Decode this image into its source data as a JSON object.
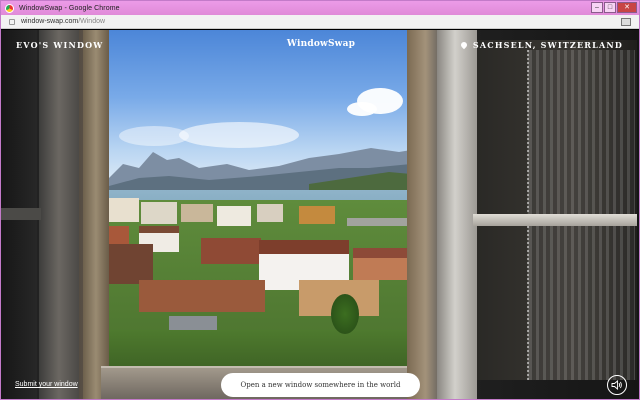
{
  "browser": {
    "title": "WindowSwap - Google Chrome",
    "url_host": "window-swap.com",
    "url_path": "/Window",
    "controls": {
      "minimize": "–",
      "maximize": "□",
      "close": "✕"
    }
  },
  "page": {
    "owner": "EVO'S WINDOW",
    "logo": "WindowSwap",
    "location": "SACHSELN, SWITZERLAND",
    "submit_link": "Submit your window",
    "open_button": "Open a new window somewhere in the world"
  },
  "icons": {
    "location": "pin-icon",
    "sound": "speaker-icon"
  }
}
